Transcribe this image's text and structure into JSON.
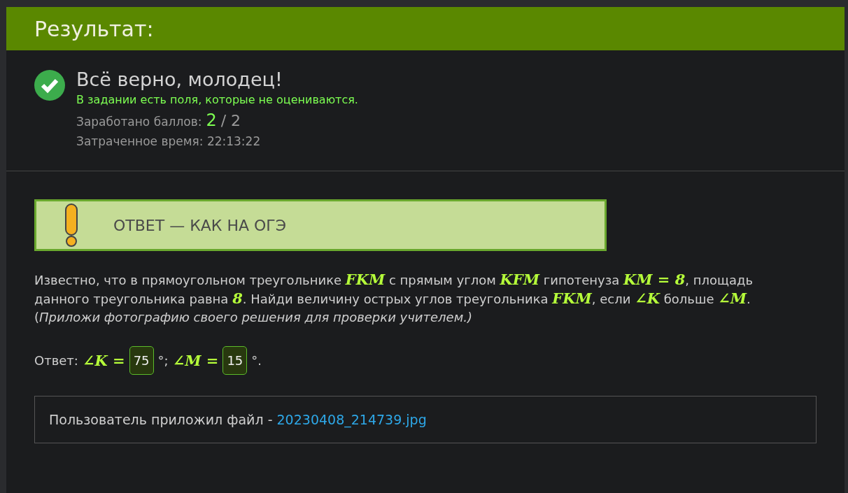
{
  "header": {
    "title": "Результат:"
  },
  "result": {
    "correct": true,
    "headline": "Всё верно, молодец!",
    "note": "В задании есть поля, которые не оцениваются.",
    "score_label": "Заработано баллов:",
    "score": "2",
    "score_max": "/ 2",
    "time": "Затраченное время: 22:13:22"
  },
  "banner": {
    "text": "ОТВЕТ — КАК НА ОГЭ"
  },
  "task": {
    "parts": [
      {
        "kind": "text",
        "text": "Известно, что в прямоугольном треугольнике "
      },
      {
        "kind": "math",
        "text": "FKM"
      },
      {
        "kind": "text",
        "text": " с прямым углом "
      },
      {
        "kind": "math",
        "text": "KFM"
      },
      {
        "kind": "text",
        "text": " гипотенуза "
      },
      {
        "kind": "math",
        "text": "KM = 8"
      },
      {
        "kind": "text",
        "text": ", площадь данного треугольника равна "
      },
      {
        "kind": "math",
        "text": "8"
      },
      {
        "kind": "text",
        "text": ". Найди величину острых углов треугольника "
      },
      {
        "kind": "math",
        "text": "FKM"
      },
      {
        "kind": "text",
        "text": ", если "
      },
      {
        "kind": "math",
        "text": "∠K"
      },
      {
        "kind": "text",
        "text": " больше "
      },
      {
        "kind": "math",
        "text": "∠M"
      },
      {
        "kind": "text",
        "text": "."
      }
    ],
    "hint_open": "(",
    "hint": "Приложи фотографию своего решения для проверки учителем.)"
  },
  "answer": {
    "label": "Ответ:",
    "items": [
      {
        "kind": "math",
        "text": "∠K ="
      },
      {
        "kind": "input",
        "value": "75"
      },
      {
        "kind": "text",
        "text": "°;"
      },
      {
        "kind": "math",
        "text": "∠M ="
      },
      {
        "kind": "input",
        "value": "15"
      },
      {
        "kind": "text",
        "text": "°."
      }
    ]
  },
  "attachment": {
    "text": "Пользователь приложил файл - ",
    "link": "20230408_214739.jpg"
  }
}
